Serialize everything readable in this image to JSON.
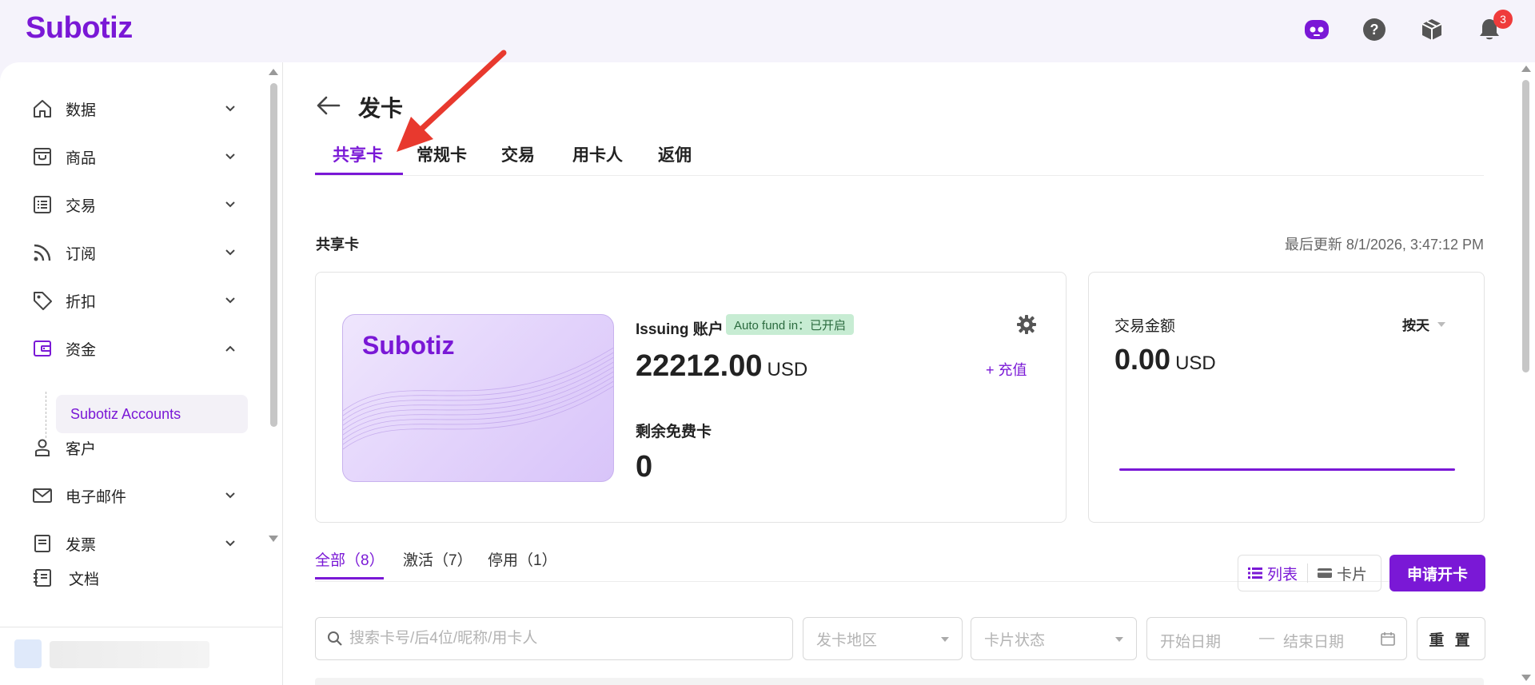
{
  "app": {
    "logo": "Subotiz"
  },
  "header": {
    "icons": [
      "assistant-icon",
      "help-icon",
      "package-icon",
      "bell-icon"
    ],
    "notification_count": "3"
  },
  "sidebar": {
    "items": [
      {
        "label": "数据",
        "icon": "home-icon"
      },
      {
        "label": "商品",
        "icon": "store-icon"
      },
      {
        "label": "交易",
        "icon": "list-icon"
      },
      {
        "label": "订阅",
        "icon": "rss-icon"
      },
      {
        "label": "折扣",
        "icon": "tag-icon"
      },
      {
        "label": "资金",
        "icon": "wallet-icon"
      },
      {
        "label": "客户",
        "icon": "user-icon"
      },
      {
        "label": "电子邮件",
        "icon": "mail-icon"
      },
      {
        "label": "发票",
        "icon": "invoice-icon"
      }
    ],
    "sub_item": "Subotiz Accounts",
    "docs_label": "文档"
  },
  "page": {
    "title": "发卡",
    "tabs": [
      "共享卡",
      "常规卡",
      "交易",
      "用卡人",
      "返佣"
    ],
    "section_label": "共享卡",
    "last_updated": "最后更新 8/1/2026, 3:47:12 PM"
  },
  "card_panel": {
    "card_logo": "Subotiz",
    "account_title": "Issuing 账户",
    "fund_badge": "Auto fund in：已开启",
    "balance": "22212.00",
    "currency": "USD",
    "recharge": "+ 充值",
    "free_cards_title": "剩余免费卡",
    "free_cards_value": "0"
  },
  "amount_panel": {
    "title": "交易金额",
    "period": "按天",
    "value": "0.00",
    "currency": "USD"
  },
  "filters": {
    "tabs": [
      "全部（8）",
      "激活（7）",
      "停用（1）"
    ],
    "view_list": "列表",
    "view_card": "卡片",
    "apply_button": "申请开卡",
    "search_placeholder": "搜索卡号/后4位/昵称/用卡人",
    "region_placeholder": "发卡地区",
    "status_placeholder": "卡片状态",
    "start_date": "开始日期",
    "date_sep": "—",
    "end_date": "结束日期",
    "reset": "重 置"
  },
  "colors": {
    "accent": "#7a18d6",
    "badge_bg": "#c7ecd3",
    "badge_red": "#ef3b3b",
    "arrow_red": "#e8392e"
  }
}
